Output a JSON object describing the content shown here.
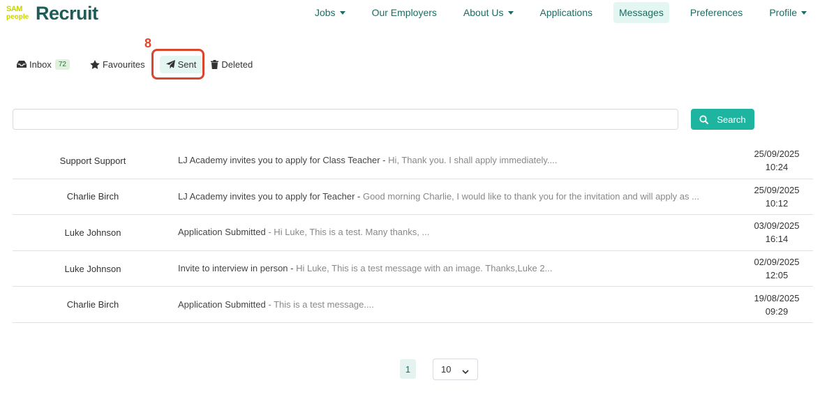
{
  "brand": {
    "mark_top": "SAM",
    "mark_bottom": "people",
    "name": "Recruit"
  },
  "nav": {
    "items": [
      {
        "label": "Jobs",
        "dropdown": true
      },
      {
        "label": "Our Employers",
        "dropdown": false
      },
      {
        "label": "About Us",
        "dropdown": true
      },
      {
        "label": "Applications",
        "dropdown": false
      },
      {
        "label": "Messages",
        "dropdown": false,
        "active": true
      },
      {
        "label": "Preferences",
        "dropdown": false
      },
      {
        "label": "Profile",
        "dropdown": true
      }
    ]
  },
  "annotation": {
    "number": "8"
  },
  "folders": {
    "inbox": {
      "label": "Inbox",
      "count": "72",
      "icon": "inbox-icon"
    },
    "favourites": {
      "label": "Favourites",
      "icon": "star-icon"
    },
    "sent": {
      "label": "Sent",
      "icon": "paper-plane-icon",
      "active": true
    },
    "deleted": {
      "label": "Deleted",
      "icon": "trash-icon"
    }
  },
  "search": {
    "placeholder": "",
    "value": "",
    "button_label": "Search"
  },
  "messages": [
    {
      "from": "Support Support",
      "subject": "LJ Academy invites you to apply for Class Teacher - ",
      "preview": "Hi, Thank you. I shall apply immediately....",
      "date": "25/09/2025",
      "time": "10:24"
    },
    {
      "from": "Charlie Birch",
      "subject": "LJ Academy invites you to apply for Teacher - ",
      "preview": "Good morning Charlie, I would like to thank you for the invitation and will apply as ...",
      "date": "25/09/2025",
      "time": "10:12"
    },
    {
      "from": "Luke Johnson",
      "subject": "Application Submitted",
      "preview": " - Hi Luke, This is a test. Many thanks, ...",
      "date": "03/09/2025",
      "time": "16:14"
    },
    {
      "from": "Luke Johnson",
      "subject": "Invite to interview in person - ",
      "preview": "Hi Luke, This is a test message with an image. Thanks,Luke 2...",
      "date": "02/09/2025",
      "time": "12:05"
    },
    {
      "from": "Charlie Birch",
      "subject": "Application Submitted",
      "preview": " - This is a test message....",
      "date": "19/08/2025",
      "time": "09:29"
    }
  ],
  "pagination": {
    "current_page": "1",
    "page_size": "10"
  },
  "colors": {
    "accent": "#1eb5a0",
    "brand_text": "#1f5c57",
    "nav_text": "#1e6b62",
    "highlight": "#d9462c",
    "logo_yellow": "#c8d400"
  }
}
